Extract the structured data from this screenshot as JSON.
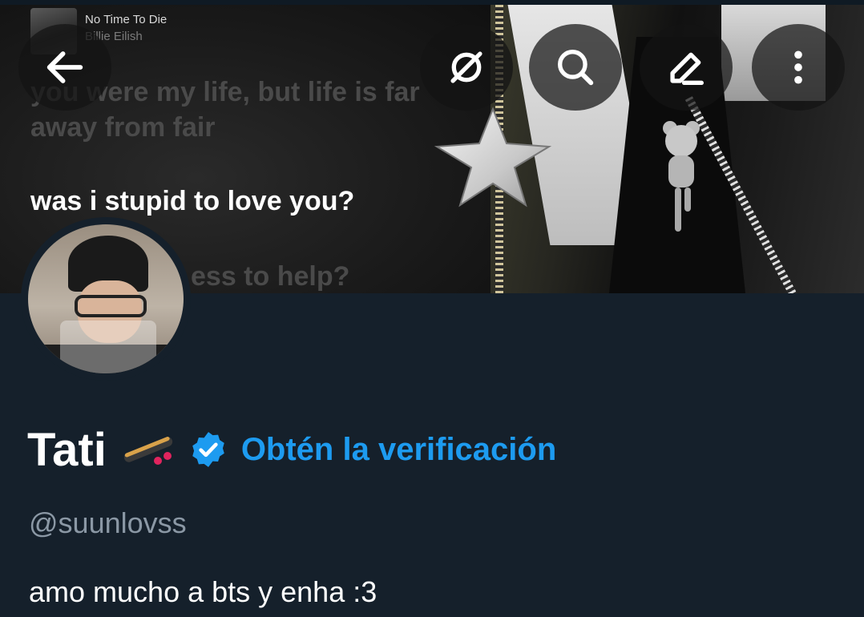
{
  "now_playing": {
    "title": "No Time To Die",
    "artist": "Billie Eilish"
  },
  "lyrics": {
    "line1": "you were my life, but life is far",
    "line2": "away from fair",
    "current": "was i stupid to love you?",
    "next": "ess to help?"
  },
  "header_buttons": {
    "back": "back-arrow-icon",
    "grok": "grok-icon",
    "search": "search-icon",
    "edit": "edit-pencil-icon",
    "more": "more-vertical-icon"
  },
  "profile": {
    "display_name": "Tati",
    "name_emoji": "skateboard",
    "verification_cta": "Obtén la verificación",
    "handle": "@suunlovss",
    "bio": "amo mucho a bts y enha :3"
  },
  "colors": {
    "background": "#15202b",
    "accent": "#1d9bf0",
    "secondary_text": "#8b98a5"
  }
}
